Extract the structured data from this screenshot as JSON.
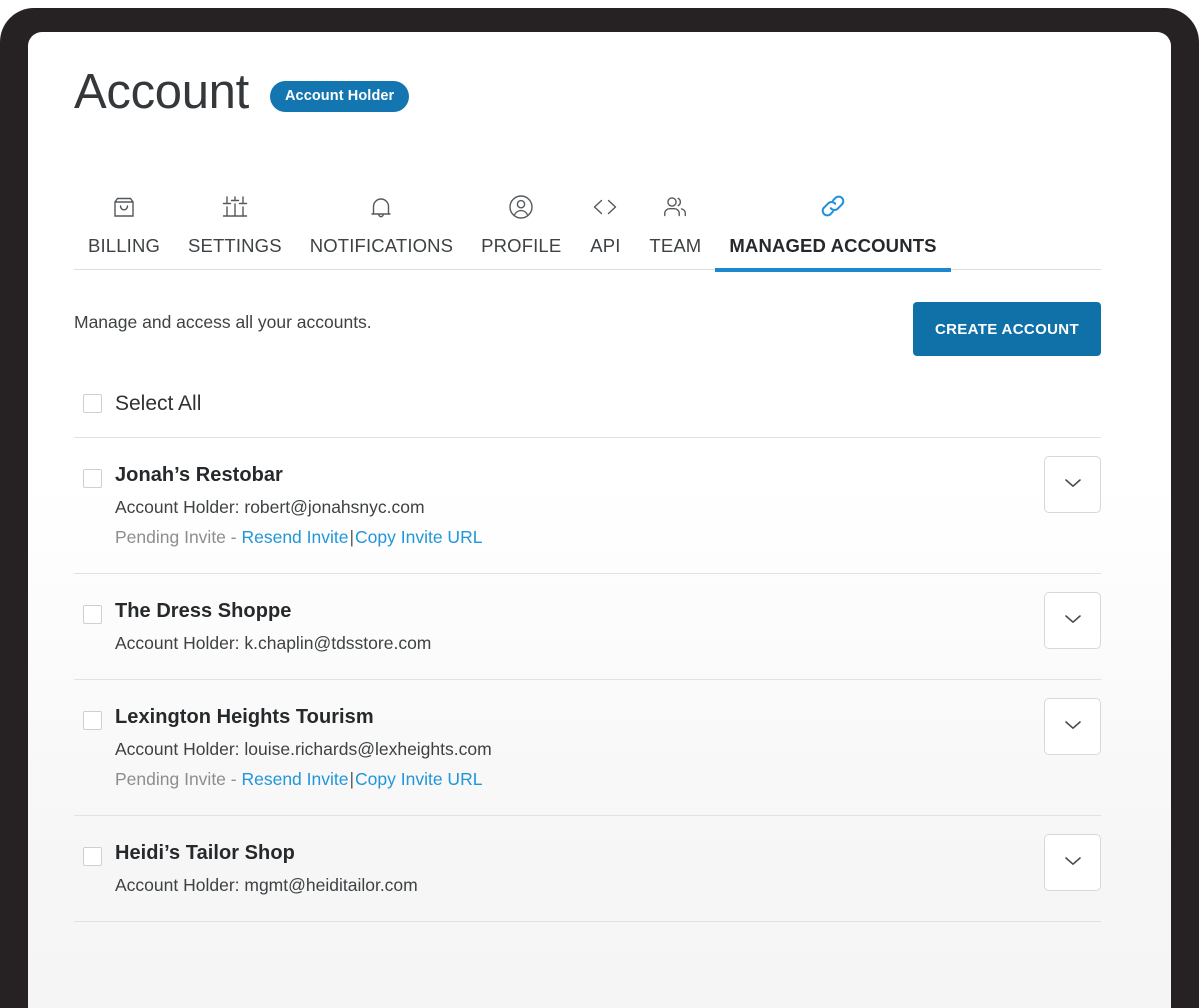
{
  "header": {
    "title": "Account",
    "role_badge": "Account Holder"
  },
  "tabs": [
    {
      "label": "BILLING",
      "icon": "bag-icon",
      "active": false
    },
    {
      "label": "SETTINGS",
      "icon": "sliders-icon",
      "active": false
    },
    {
      "label": "NOTIFICATIONS",
      "icon": "bell-icon",
      "active": false
    },
    {
      "label": "PROFILE",
      "icon": "user-circle-icon",
      "active": false
    },
    {
      "label": "API",
      "icon": "code-icon",
      "active": false
    },
    {
      "label": "TEAM",
      "icon": "people-icon",
      "active": false
    },
    {
      "label": "MANAGED ACCOUNTS",
      "icon": "link-icon",
      "active": true
    }
  ],
  "intro": {
    "text": "Manage and access all your accounts.",
    "create_button": "CREATE ACCOUNT"
  },
  "list": {
    "select_all_label": "Select All",
    "holder_prefix": "Account Holder: ",
    "pending_label": "Pending Invite - ",
    "resend_label": "Resend Invite",
    "separator": "|",
    "copy_url_label": "Copy Invite URL",
    "accounts": [
      {
        "name": "Jonah’s Restobar",
        "holder": "robert@jonahsnyc.com",
        "pending": true
      },
      {
        "name": "The Dress Shoppe",
        "holder": "k.chaplin@tdsstore.com",
        "pending": false
      },
      {
        "name": "Lexington Heights Tourism",
        "holder": "louise.richards@lexheights.com",
        "pending": true
      },
      {
        "name": "Heidi’s Tailor Shop",
        "holder": "mgmt@heiditailor.com",
        "pending": false
      }
    ]
  },
  "colors": {
    "brand_blue": "#1071a9",
    "badge_blue": "#1476b0",
    "link_blue": "#2196d8",
    "active_underline": "#1e88cf",
    "bezel": "#262223",
    "text_dark": "#26292b",
    "text_body": "#3e4244",
    "text_muted": "#8d8d8d"
  }
}
